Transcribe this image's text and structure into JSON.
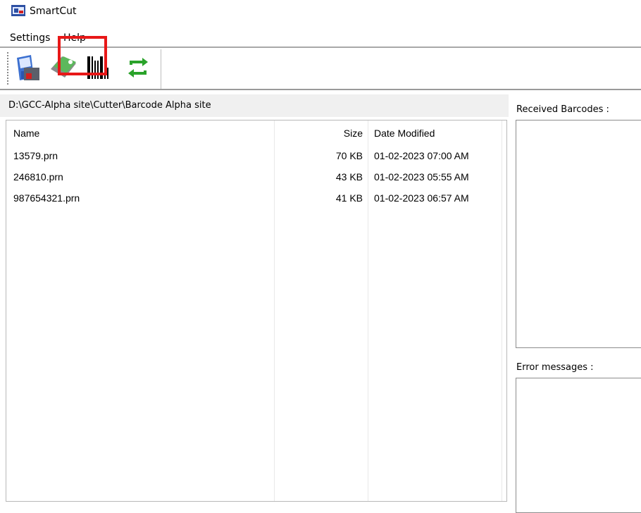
{
  "app": {
    "title": "SmartCut"
  },
  "menu": {
    "items": [
      "Settings",
      "Help"
    ]
  },
  "toolbar": {
    "buttons": [
      {
        "icon": "save-to-cutter-icon"
      },
      {
        "icon": "tag-label-icon"
      },
      {
        "icon": "barcode-icon"
      },
      {
        "icon": "refresh-icon"
      }
    ]
  },
  "path": "D:\\GCC-Alpha site\\Cutter\\Barcode Alpha site",
  "files": {
    "headers": {
      "name": "Name",
      "size": "Size",
      "date": "Date Modified"
    },
    "rows": [
      {
        "name": "13579.prn",
        "size": "70 KB",
        "date": "01-02-2023 07:00 AM"
      },
      {
        "name": "246810.prn",
        "size": "43 KB",
        "date": "01-02-2023 05:55 AM"
      },
      {
        "name": "987654321.prn",
        "size": "41 KB",
        "date": "01-02-2023 06:57 AM"
      }
    ]
  },
  "panels": {
    "received_label": "Received Barcodes :",
    "error_label": "Error messages :"
  },
  "colors": {
    "highlight": "#e81818",
    "refresh": "#2aa32a",
    "tag": "#5cb85c"
  }
}
